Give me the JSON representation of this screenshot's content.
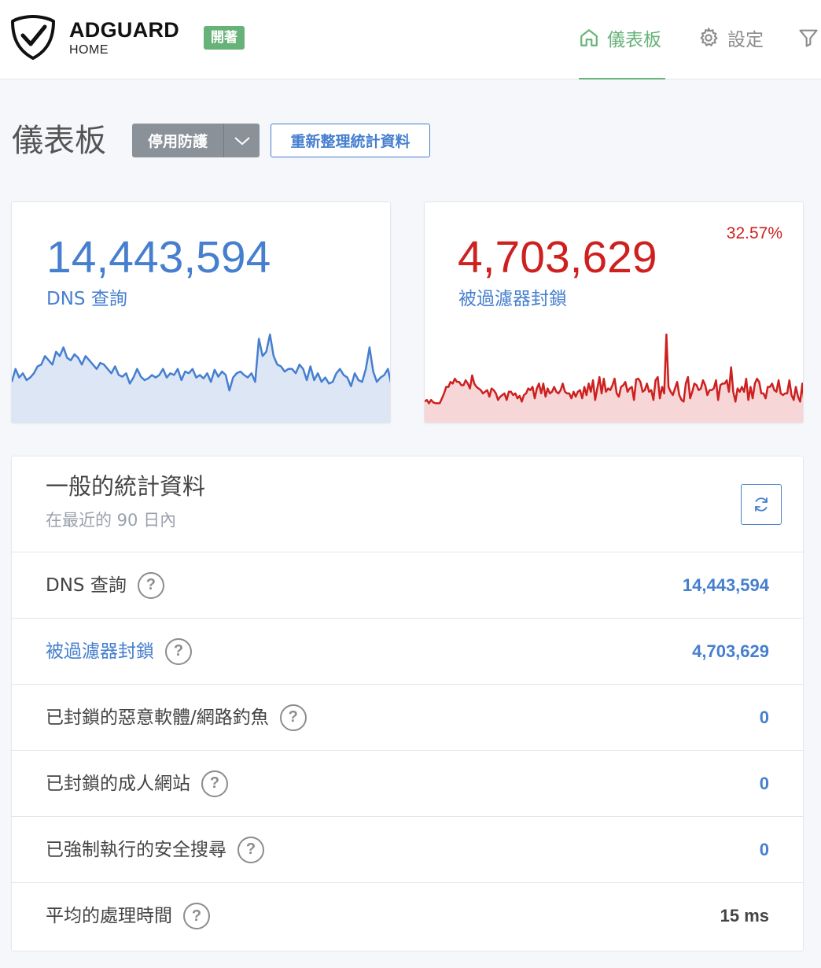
{
  "header": {
    "brand": "ADGUARD",
    "brand_sub": "HOME",
    "status_badge": "開著",
    "nav": [
      {
        "label": "儀表板",
        "icon": "home-icon",
        "active": true
      },
      {
        "label": "設定",
        "icon": "gear-icon",
        "active": false
      },
      {
        "label": "",
        "icon": "filter-icon",
        "active": false
      }
    ]
  },
  "page": {
    "title": "儀表板",
    "disable_protection_label": "停用防護",
    "refresh_stats_label": "重新整理統計資料"
  },
  "cards": {
    "dns_queries": {
      "value": "14,443,594",
      "label": "DNS 查詢",
      "color": "#467fcf",
      "sparkline": [
        40,
        55,
        45,
        50,
        42,
        45,
        50,
        58,
        60,
        70,
        65,
        60,
        75,
        70,
        80,
        68,
        65,
        72,
        68,
        60,
        70,
        65,
        60,
        55,
        62,
        60,
        55,
        50,
        58,
        48,
        46,
        50,
        38,
        45,
        55,
        46,
        42,
        44,
        48,
        45,
        48,
        55,
        45,
        50,
        48,
        55,
        42,
        52,
        50,
        55,
        45,
        48,
        44,
        50,
        40,
        54,
        46,
        52,
        48,
        30,
        45,
        50,
        52,
        48,
        45,
        50,
        40,
        90,
        70,
        75,
        95,
        70,
        60,
        58,
        52,
        55,
        55,
        50,
        60,
        55,
        42,
        58,
        42,
        50,
        40,
        45,
        38,
        40,
        50,
        55,
        48,
        45,
        35,
        50,
        42,
        40,
        55,
        80,
        52,
        40,
        45,
        48,
        55,
        35
      ]
    },
    "blocked": {
      "value": "4,703,629",
      "label": "被過濾器封鎖",
      "percent": "32.57%",
      "color": "#cd201f",
      "sparkline": [
        18,
        20,
        16,
        20,
        17,
        16,
        16,
        16,
        22,
        28,
        36,
        36,
        42,
        40,
        46,
        42,
        42,
        38,
        38,
        44,
        40,
        34,
        50,
        40,
        36,
        34,
        32,
        28,
        30,
        32,
        24,
        34,
        32,
        28,
        20,
        24,
        26,
        28,
        20,
        30,
        30,
        26,
        28,
        22,
        25,
        18,
        26,
        28,
        34,
        32,
        36,
        22,
        34,
        40,
        28,
        40,
        24,
        34,
        28,
        30,
        36,
        30,
        28,
        32,
        40,
        30,
        28,
        28,
        22,
        30,
        24,
        30,
        32,
        22,
        36,
        26,
        40,
        30,
        44,
        20,
        34,
        48,
        28,
        46,
        30,
        34,
        32,
        38,
        46,
        28,
        24,
        36,
        38,
        42,
        30,
        34,
        36,
        20,
        45,
        46,
        42,
        30,
        32,
        40,
        30,
        32,
        20,
        44,
        48,
        22,
        36,
        28,
        100,
        36,
        30,
        26,
        34,
        42,
        26,
        20,
        18,
        40,
        48,
        22,
        30,
        40,
        38,
        32,
        34,
        44,
        38,
        26,
        32,
        32,
        34,
        44,
        20,
        38,
        40,
        40,
        44,
        30,
        60,
        30,
        18,
        34,
        30,
        36,
        30,
        46,
        20,
        36,
        22,
        40,
        46,
        42,
        28,
        28,
        22,
        36,
        36,
        40,
        32,
        30,
        44,
        28,
        26,
        28,
        28,
        44,
        26,
        20,
        36,
        24,
        18,
        40,
        14
      ]
    }
  },
  "general_stats": {
    "title": "一般的統計資料",
    "subtitle": "在最近的 90 日內",
    "rows": [
      {
        "label": "DNS 查詢",
        "value": "14,443,594",
        "is_link": false,
        "value_color": "#467fcf"
      },
      {
        "label": "被過濾器封鎖",
        "value": "4,703,629",
        "is_link": true,
        "value_color": "#467fcf"
      },
      {
        "label": "已封鎖的惡意軟體/網路釣魚",
        "value": "0",
        "is_link": false,
        "value_color": "#467fcf"
      },
      {
        "label": "已封鎖的成人網站",
        "value": "0",
        "is_link": false,
        "value_color": "#467fcf"
      },
      {
        "label": "已強制執行的安全搜尋",
        "value": "0",
        "is_link": false,
        "value_color": "#467fcf"
      },
      {
        "label": "平均的處理時間",
        "value": "15 ms",
        "is_link": false,
        "value_color": "#444444"
      }
    ],
    "help_glyph": "?"
  }
}
